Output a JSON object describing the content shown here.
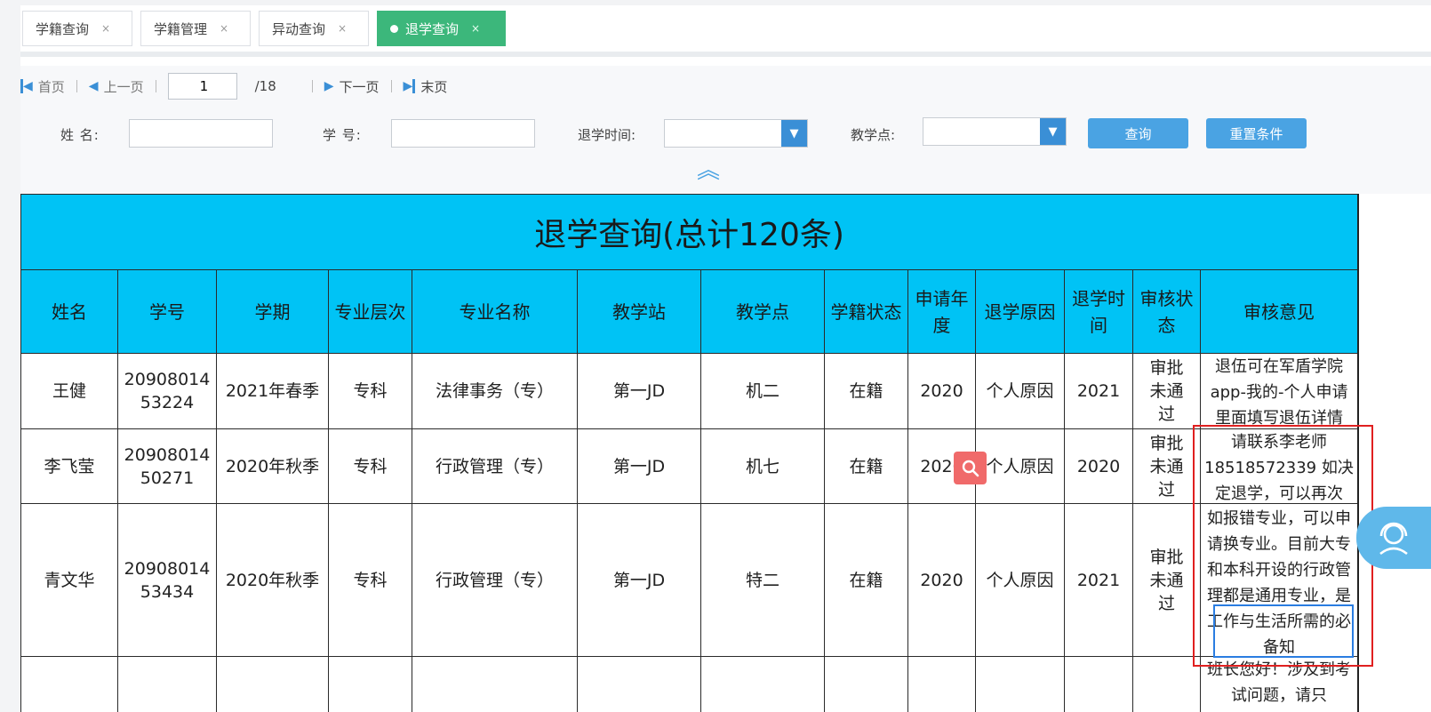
{
  "tabs": [
    {
      "label": "学籍查询",
      "close": "×"
    },
    {
      "label": "学籍管理",
      "close": "×"
    },
    {
      "label": "异动查询",
      "close": "×"
    },
    {
      "label": "退学查询",
      "close": "×"
    }
  ],
  "pager": {
    "first": "首页",
    "prev": "上一页",
    "current": "1",
    "total": "/18",
    "next": "下一页",
    "last": "末页"
  },
  "filters": {
    "name_label": "姓 名:",
    "id_label": "学 号:",
    "time_label": "退学时间:",
    "point_label": "教学点:",
    "search_btn": "查询",
    "reset_btn": "重置条件"
  },
  "table": {
    "title": "退学查询(总计120条)",
    "headers": [
      "姓名",
      "学号",
      "学期",
      "专业层次",
      "专业名称",
      "教学站",
      "教学点",
      "学籍状态",
      "申请年度",
      "退学原因",
      "退学时间",
      "审核状态",
      "审核意见"
    ],
    "rows": [
      {
        "name": "王健",
        "id": "2090801453224",
        "term": "2021年春季",
        "level": "专科",
        "major": "法律事务（专）",
        "station": "第一JD",
        "point": "机二",
        "status": "在籍",
        "year": "2020",
        "reason": "个人原因",
        "time": "2021",
        "review": "审批未通过",
        "opinion": "退伍可在军盾学院app-我的-个人申请里面填写退伍详情"
      },
      {
        "name": "李飞莹",
        "id": "2090801450271",
        "term": "2020年秋季",
        "level": "专科",
        "major": "行政管理（专）",
        "station": "第一JD",
        "point": "机七",
        "status": "在籍",
        "year": "2020",
        "reason": "个人原因",
        "time": "2020",
        "review": "审批未通过",
        "opinion": "请联系李老师18518572339 如决定退学，可以再次"
      },
      {
        "name": "青文华",
        "id": "2090801453434",
        "term": "2020年秋季",
        "level": "专科",
        "major": "行政管理（专）",
        "station": "第一JD",
        "point": "特二",
        "status": "在籍",
        "year": "2020",
        "reason": "个人原因",
        "time": "2021",
        "review": "审批未通过",
        "opinion": "如报错专业，可以申请换专业。目前大专和本科开设的行政管理都是通用专业，是工作与生活所需的必备知"
      },
      {
        "name": "",
        "id": "",
        "term": "",
        "level": "",
        "major": "",
        "station": "",
        "point": "",
        "status": "",
        "year": "",
        "reason": "",
        "time": "",
        "review": "",
        "opinion": "班长您好！涉及到考试问题，请只"
      }
    ]
  },
  "icons": {
    "zoom": "search-zoom-icon",
    "service": "customer-service-icon",
    "collapse": "collapse-chevrons-icon"
  }
}
